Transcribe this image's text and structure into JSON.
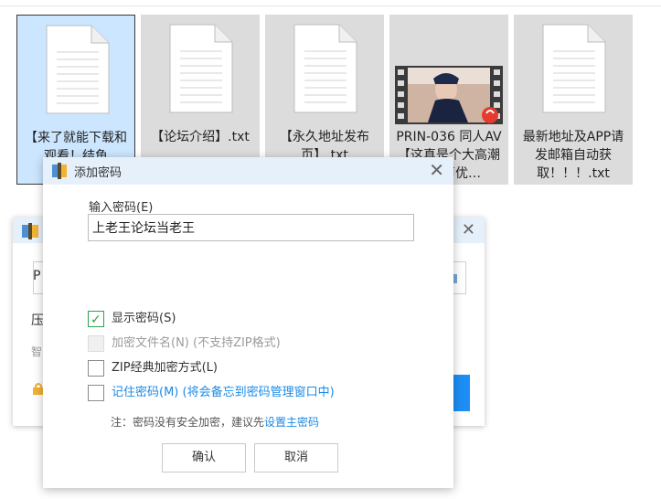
{
  "files": [
    {
      "name": "【来了就能下载和观看！结鱼",
      "selected": true,
      "kind": "document"
    },
    {
      "name": "【论坛介绍】.txt",
      "selected": false,
      "kind": "document"
    },
    {
      "name": "【永久地址发布页】.txt",
      "selected": false,
      "kind": "document"
    },
    {
      "name": "PRIN-036 同人AV【这真是个大高潮过…声优…",
      "selected": false,
      "kind": "video"
    },
    {
      "name": "最新地址及APP请发邮箱自动获取！！！.txt",
      "selected": false,
      "kind": "document"
    }
  ],
  "bg_dialog": {
    "field_text": "P",
    "text1": "压",
    "text2": "智"
  },
  "dialog": {
    "title": "添加密码",
    "close": "✕",
    "input_label": "输入密码(E)",
    "password_value": "上老王论坛当老王",
    "options": [
      {
        "label": "显示密码(S)",
        "checked": true,
        "disabled": false
      },
      {
        "label": "加密文件名(N) (不支持ZIP格式)",
        "checked": false,
        "disabled": true
      },
      {
        "label": "ZIP经典加密方式(L)",
        "checked": false,
        "disabled": false
      },
      {
        "label": "记住密码(M) (将会备忘到密码管理窗口中)",
        "checked": false,
        "disabled": false
      }
    ],
    "note_prefix": "注：密码没有安全加密，建议先",
    "note_link": "设置主密码",
    "ok_label": "确认",
    "cancel_label": "取消"
  },
  "colors": {
    "accent": "#1a8ae6",
    "selected_tile": "#cce6ff",
    "check": "#2aa34a"
  }
}
